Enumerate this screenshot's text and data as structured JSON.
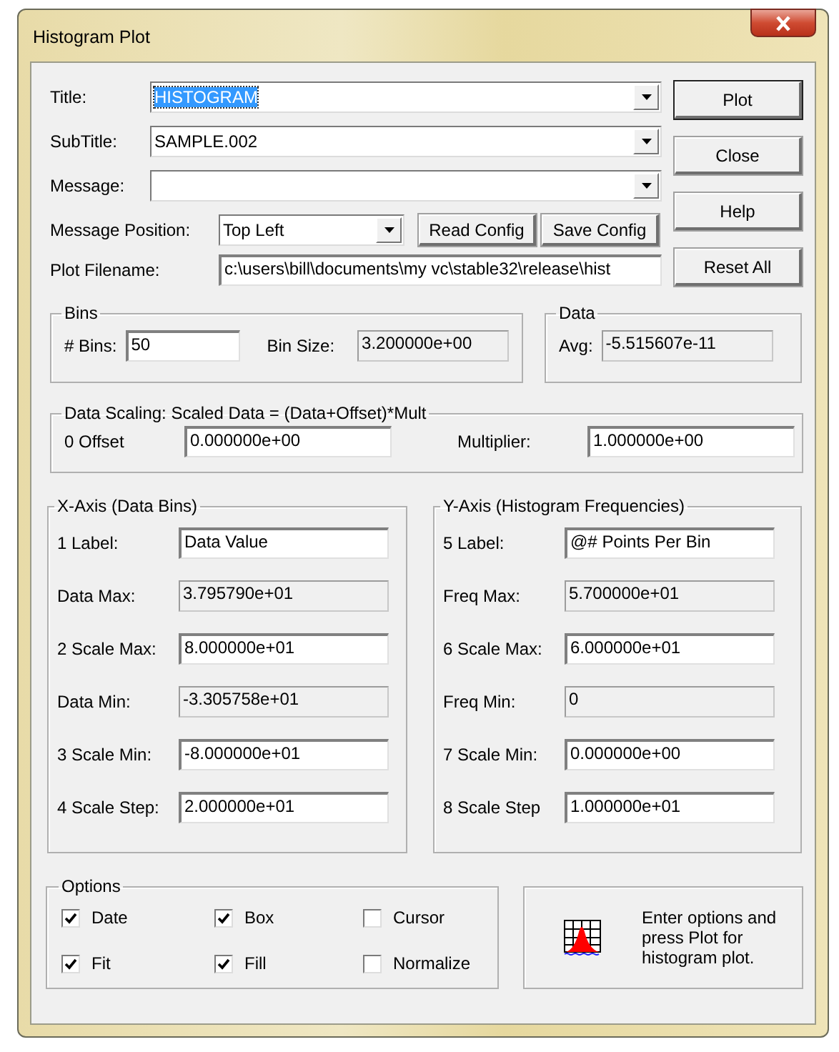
{
  "window": {
    "title": "Histogram Plot"
  },
  "main_fields": [
    {
      "label": "Title:",
      "kind": "combo",
      "value": "HISTOGRAM",
      "text_selected": true
    },
    {
      "label": "SubTitle:",
      "kind": "combo",
      "value": "SAMPLE.002",
      "text_selected": false
    },
    {
      "label": "Message:",
      "kind": "combo"
    }
  ],
  "message_position": {
    "label": "Message Position:",
    "value": "Top Left"
  },
  "config_buttons": [
    "Read Config",
    "Save Config"
  ],
  "plot_filename": {
    "label": "Plot Filename:",
    "value": "c:\\users\\bill\\documents\\my vc\\stable32\\release\\hist"
  },
  "side_buttons": [
    "Plot",
    "Close",
    "Help",
    "Reset All"
  ],
  "bins": {
    "title": "Bins",
    "fields": [
      {
        "label": "# Bins:",
        "kind": "input",
        "value": "50"
      },
      {
        "label": "Bin Size:",
        "kind": "readonly",
        "value": "3.200000e+00"
      }
    ]
  },
  "data": {
    "title": "Data",
    "fields": [
      {
        "label": "Avg:",
        "kind": "readonly",
        "value": "-5.515607e-11"
      }
    ]
  },
  "scaling": {
    "title": "Data Scaling: Scaled Data = (Data+Offset)*Mult",
    "fields": [
      {
        "label": "0 Offset",
        "value": "0.000000e+00"
      },
      {
        "label": "Multiplier:",
        "value": "1.000000e+00"
      }
    ]
  },
  "axes": [
    {
      "title": "X-Axis (Data Bins)",
      "fields": [
        {
          "label": "1 Label:",
          "kind": "input",
          "value": "Data Value"
        },
        {
          "label": "Data Max:",
          "kind": "readonly",
          "value": "3.795790e+01"
        },
        {
          "label": "2 Scale Max:",
          "kind": "input",
          "value": "8.000000e+01"
        },
        {
          "label": "Data Min:",
          "kind": "readonly",
          "value": "-3.305758e+01"
        },
        {
          "label": "3 Scale Min:",
          "kind": "input",
          "value": "-8.000000e+01"
        },
        {
          "label": "4 Scale Step:",
          "kind": "input",
          "value": "2.000000e+01"
        }
      ]
    },
    {
      "title": "Y-Axis (Histogram Frequencies)",
      "fields": [
        {
          "label": "5 Label:",
          "kind": "input",
          "value": "@# Points Per Bin"
        },
        {
          "label": "Freq Max:",
          "kind": "readonly",
          "value": "5.700000e+01"
        },
        {
          "label": "6 Scale Max:",
          "kind": "input",
          "value": "6.000000e+01"
        },
        {
          "label": "Freq Min:",
          "kind": "readonly",
          "value": "0"
        },
        {
          "label": "7 Scale Min:",
          "kind": "input",
          "value": "0.000000e+00"
        },
        {
          "label": "8 Scale Step",
          "kind": "input",
          "value": "1.000000e+01"
        }
      ]
    }
  ],
  "options": {
    "title": "Options",
    "items": [
      {
        "label": "Date",
        "checked": true
      },
      {
        "label": "Box",
        "checked": true
      },
      {
        "label": "Cursor",
        "checked": false
      },
      {
        "label": "Fit",
        "checked": true
      },
      {
        "label": "Fill",
        "checked": true
      },
      {
        "label": "Normalize",
        "checked": false
      }
    ]
  },
  "info": {
    "text": "Enter options and press Plot for histogram plot."
  }
}
